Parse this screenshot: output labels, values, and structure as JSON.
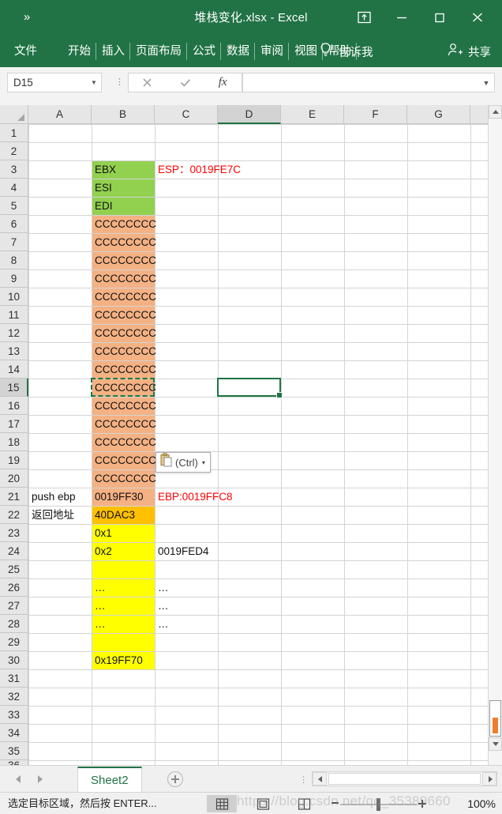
{
  "window": {
    "title": "堆栈变化.xlsx  -  Excel",
    "qat_more": "»",
    "buttons": {
      "ribbon_display": "ribbon-display-options-icon",
      "minimize": "minimize-icon",
      "maximize": "maximize-icon",
      "close": "close-icon"
    }
  },
  "ribbon": {
    "tabs": [
      {
        "label": "文件"
      },
      {
        "label": "开始"
      },
      {
        "label": "插入"
      },
      {
        "label": "页面布局"
      },
      {
        "label": "公式"
      },
      {
        "label": "数据"
      },
      {
        "label": "审阅"
      },
      {
        "label": "视图"
      },
      {
        "label": "帮助"
      }
    ],
    "tellme": "告诉我",
    "share": "共享",
    "accent_color": "#217346"
  },
  "formula_bar": {
    "name_box_value": "D15",
    "cancel_icon": "cancel-icon",
    "enter_icon": "confirm-icon",
    "function_icon": "fx",
    "formula_value": ""
  },
  "grid": {
    "columns": [
      "A",
      "B",
      "C",
      "D",
      "E",
      "F",
      "G"
    ],
    "selected_column": "D",
    "selected_row": 15,
    "active_cell": "D15",
    "rows": [
      1,
      2,
      3,
      4,
      5,
      6,
      7,
      8,
      9,
      10,
      11,
      12,
      13,
      14,
      15,
      16,
      17,
      18,
      19,
      20,
      21,
      22,
      23,
      24,
      25,
      26,
      27,
      28,
      29,
      30,
      31,
      32,
      33,
      34,
      35
    ],
    "cells": [
      {
        "col": "B",
        "row": 3,
        "text": "EBX",
        "fill": "#92d050"
      },
      {
        "col": "C",
        "row": 3,
        "text": "ESP：0019FE7C",
        "color": "#ff0000"
      },
      {
        "col": "B",
        "row": 4,
        "text": "ESI",
        "fill": "#92d050"
      },
      {
        "col": "B",
        "row": 5,
        "text": "EDI",
        "fill": "#92d050"
      },
      {
        "col": "B",
        "row": 6,
        "text": "CCCCCCCC",
        "fill": "#f4b183"
      },
      {
        "col": "B",
        "row": 7,
        "text": "CCCCCCCC",
        "fill": "#f4b183"
      },
      {
        "col": "B",
        "row": 8,
        "text": "CCCCCCCC",
        "fill": "#f4b183"
      },
      {
        "col": "B",
        "row": 9,
        "text": "CCCCCCCC",
        "fill": "#f4b183"
      },
      {
        "col": "B",
        "row": 10,
        "text": "CCCCCCCC",
        "fill": "#f4b183"
      },
      {
        "col": "B",
        "row": 11,
        "text": "CCCCCCCC",
        "fill": "#f4b183"
      },
      {
        "col": "B",
        "row": 12,
        "text": "CCCCCCCC",
        "fill": "#f4b183"
      },
      {
        "col": "B",
        "row": 13,
        "text": "CCCCCCCC",
        "fill": "#f4b183"
      },
      {
        "col": "B",
        "row": 14,
        "text": "CCCCCCCC",
        "fill": "#f4b183"
      },
      {
        "col": "B",
        "row": 15,
        "text": "CCCCCCCC",
        "fill": "#f4b183"
      },
      {
        "col": "B",
        "row": 16,
        "text": "CCCCCCCC",
        "fill": "#f4b183"
      },
      {
        "col": "B",
        "row": 17,
        "text": "CCCCCCCC",
        "fill": "#f4b183"
      },
      {
        "col": "B",
        "row": 18,
        "text": "CCCCCCCC",
        "fill": "#f4b183"
      },
      {
        "col": "B",
        "row": 19,
        "text": "CCCCCCCC",
        "fill": "#f4b183"
      },
      {
        "col": "B",
        "row": 20,
        "text": "CCCCCCCC",
        "fill": "#f4b183"
      },
      {
        "col": "A",
        "row": 21,
        "text": "push ebp"
      },
      {
        "col": "B",
        "row": 21,
        "text": "0019FF30",
        "fill": "#f4b183"
      },
      {
        "col": "C",
        "row": 21,
        "text": "EBP:0019FFC8",
        "color": "#ff0000"
      },
      {
        "col": "A",
        "row": 22,
        "text": "返回地址"
      },
      {
        "col": "B",
        "row": 22,
        "text": "40DAC3",
        "fill": "#ffc000"
      },
      {
        "col": "B",
        "row": 23,
        "text": "0x1",
        "fill": "#ffff00"
      },
      {
        "col": "B",
        "row": 24,
        "text": "0x2",
        "fill": "#ffff00"
      },
      {
        "col": "C",
        "row": 24,
        "text": "0019FED4"
      },
      {
        "col": "B",
        "row": 25,
        "text": "",
        "fill": "#ffff00"
      },
      {
        "col": "B",
        "row": 26,
        "text": "…",
        "fill": "#ffff00"
      },
      {
        "col": "C",
        "row": 26,
        "text": "…"
      },
      {
        "col": "B",
        "row": 27,
        "text": "…",
        "fill": "#ffff00"
      },
      {
        "col": "C",
        "row": 27,
        "text": "…"
      },
      {
        "col": "B",
        "row": 28,
        "text": "…",
        "fill": "#ffff00"
      },
      {
        "col": "C",
        "row": 28,
        "text": "…"
      },
      {
        "col": "B",
        "row": 29,
        "text": "",
        "fill": "#ffff00"
      },
      {
        "col": "B",
        "row": 30,
        "text": "0x19FF70",
        "fill": "#ffff00"
      }
    ],
    "copied_range": {
      "col": "B",
      "row": 15
    }
  },
  "paste_popup": {
    "label": "(Ctrl)",
    "arrow": "▾",
    "icon": "clipboard-icon"
  },
  "sheet_bar": {
    "tabs": [
      {
        "label": "Sheet2",
        "active": true
      }
    ],
    "add_label": "+",
    "prev_icon": "nav-prev-icon",
    "next_icon": "nav-next-icon"
  },
  "status_bar": {
    "message": "选定目标区域，然后按 ENTER...",
    "views": [
      {
        "name": "normal",
        "icon": "normal-view-icon",
        "active": true
      },
      {
        "name": "layout",
        "icon": "page-layout-view-icon",
        "active": false
      },
      {
        "name": "pagebreak",
        "icon": "page-break-view-icon",
        "active": false
      }
    ],
    "zoom": "100%"
  },
  "watermark": "https://blog.csdn.net/qq_35389660"
}
